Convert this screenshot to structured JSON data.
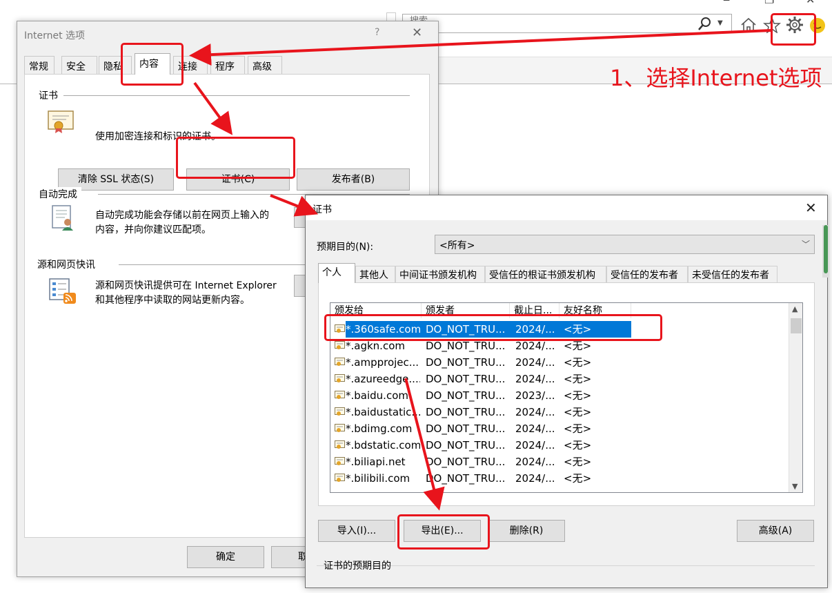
{
  "browser": {
    "search_placeholder": "搜索...",
    "tools": [
      "home-icon",
      "star-icon",
      "gear-icon",
      "smiley-icon"
    ]
  },
  "internet_options": {
    "title": "Internet 选项",
    "help": "?",
    "close": "✕",
    "tabs": [
      "常规",
      "安全",
      "隐私",
      "内容",
      "连接",
      "程序",
      "高级"
    ],
    "active_tab": "内容",
    "certificates": {
      "heading": "证书",
      "description": "使用加密连接和标识的证书。",
      "buttons": [
        "清除 SSL 状态(S)",
        "证书(C)",
        "发布者(B)"
      ]
    },
    "autocomplete": {
      "heading": "自动完成",
      "description_line1": "自动完成功能会存储以前在网页上输入的",
      "description_line2": "内容，并向你建议匹配项。"
    },
    "feeds": {
      "heading": "源和网页快讯",
      "description_line1": "源和网页快讯提供可在 Internet Explorer",
      "description_line2": "和其他程序中读取的网站更新内容。"
    },
    "ok_button": "确定",
    "cancel_button": "取"
  },
  "certificate_dialog": {
    "title": "证书",
    "close": "✕",
    "purpose_label": "预期目的(N):",
    "purpose_value": "<所有>",
    "tabs": [
      "个人",
      "其他人",
      "中间证书颁发机构",
      "受信任的根证书颁发机构",
      "受信任的发布者",
      "未受信任的发布者"
    ],
    "active_tab": "个人",
    "columns": [
      "颁发给",
      "颁发者",
      "截止日...",
      "友好名称"
    ],
    "rows": [
      {
        "issued_to": "*.360safe.com",
        "issuer": "DO_NOT_TRU...",
        "expires": "2024/...",
        "friendly": "<无>",
        "selected": true
      },
      {
        "issued_to": "*.agkn.com",
        "issuer": "DO_NOT_TRU...",
        "expires": "2024/...",
        "friendly": "<无>"
      },
      {
        "issued_to": "*.ampprojec...",
        "issuer": "DO_NOT_TRU...",
        "expires": "2024/...",
        "friendly": "<无>"
      },
      {
        "issued_to": "*.azureedge....",
        "issuer": "DO_NOT_TRU...",
        "expires": "2024/...",
        "friendly": "<无>"
      },
      {
        "issued_to": "*.baidu.com",
        "issuer": "DO_NOT_TRU...",
        "expires": "2023/...",
        "friendly": "<无>"
      },
      {
        "issued_to": "*.baidustatic...",
        "issuer": "DO_NOT_TRU...",
        "expires": "2024/...",
        "friendly": "<无>"
      },
      {
        "issued_to": "*.bdimg.com",
        "issuer": "DO_NOT_TRU...",
        "expires": "2024/...",
        "friendly": "<无>"
      },
      {
        "issued_to": "*.bdstatic.com",
        "issuer": "DO_NOT_TRU...",
        "expires": "2024/...",
        "friendly": "<无>"
      },
      {
        "issued_to": "*.biliapi.net",
        "issuer": "DO_NOT_TRU...",
        "expires": "2024/...",
        "friendly": "<无>"
      },
      {
        "issued_to": "*.bilibili.com",
        "issuer": "DO_NOT_TRU...",
        "expires": "2024/...",
        "friendly": "<无>"
      }
    ],
    "buttons": {
      "import": "导入(I)...",
      "export": "导出(E)...",
      "remove": "删除(R)",
      "advanced": "高级(A)"
    },
    "purpose_section_title": "证书的预期目的"
  },
  "annotation": {
    "step_text": "1、选择Internet选项",
    "color": "#e8141c"
  },
  "colors": {
    "selection": "#0078d7",
    "dialog_bg": "#f0f0f0",
    "button_bg": "#e1e1e1"
  }
}
